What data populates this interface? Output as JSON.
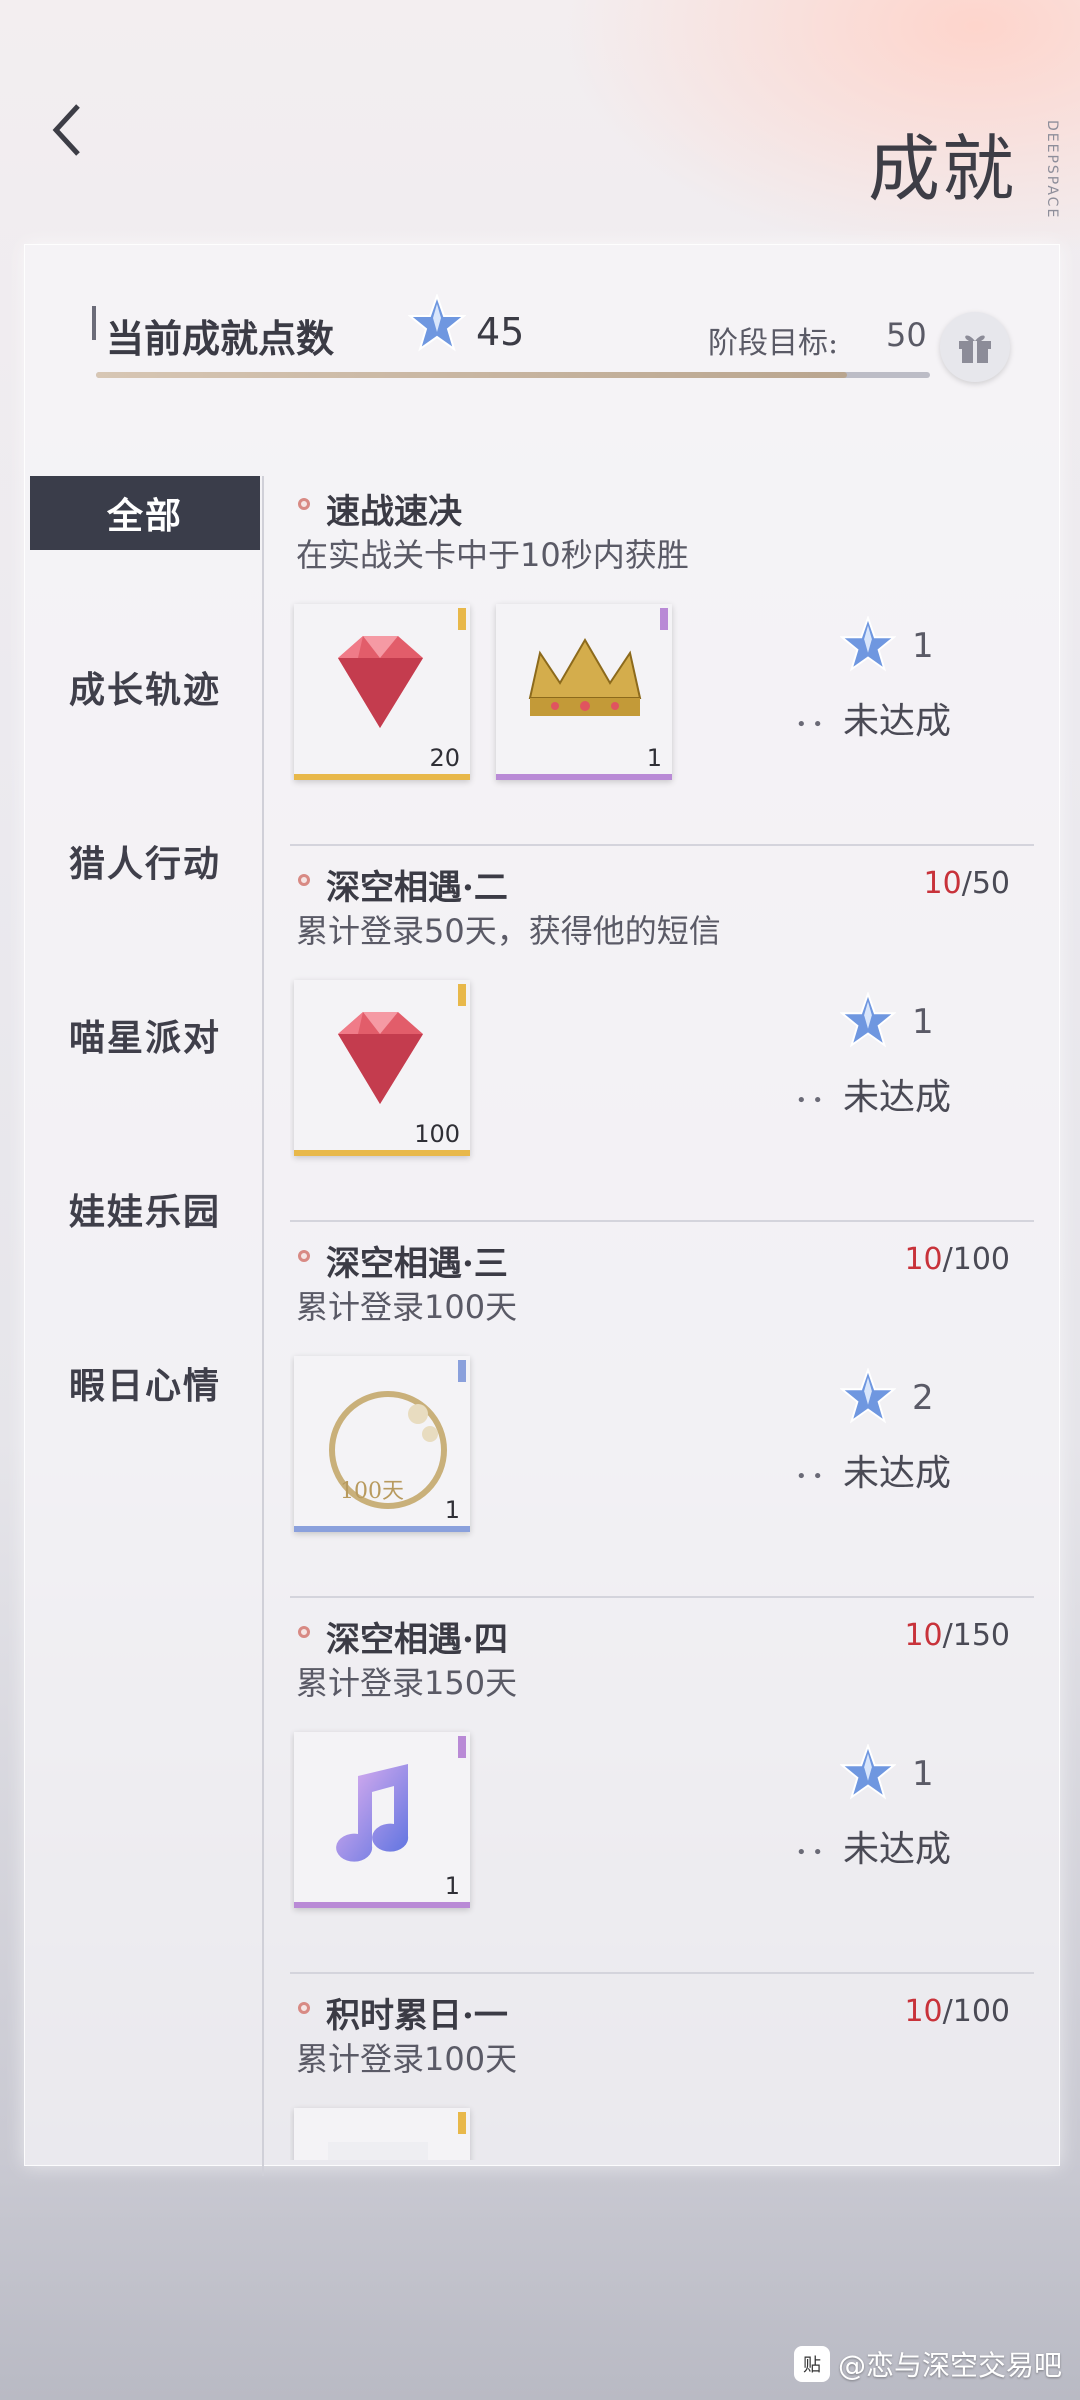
{
  "header": {
    "title": "成就",
    "brand_vertical": "DEEPSPACE"
  },
  "summary": {
    "points_label": "当前成就点数",
    "points_value": "45",
    "goal_label": "阶段目标:",
    "goal_value": "50",
    "progress_fraction": 0.9
  },
  "sidebar": {
    "items": [
      {
        "label": "全部",
        "active": true
      },
      {
        "label": "成长轨迹"
      },
      {
        "label": "猎人行动"
      },
      {
        "label": "喵星派对"
      },
      {
        "label": "娃娃乐园"
      },
      {
        "label": "暇日心情"
      }
    ]
  },
  "achievements": [
    {
      "title": "速战速决",
      "desc": "在实战关卡中于10秒内获胜",
      "progress_current": "",
      "progress_total": "",
      "rewards": [
        {
          "icon": "red-diamond-icon",
          "qty": "20",
          "bar_color": "#e8b84a"
        },
        {
          "icon": "gold-crown-icon",
          "qty": "1",
          "bar_color": "#b98ad6"
        }
      ],
      "star_count": "1",
      "status": "未达成"
    },
    {
      "title": "深空相遇·二",
      "desc": "累计登录50天，获得他的短信",
      "progress_current": "10",
      "progress_total": "/50",
      "rewards": [
        {
          "icon": "red-diamond-icon",
          "qty": "100",
          "bar_color": "#e8b84a"
        }
      ],
      "star_count": "1",
      "status": "未达成"
    },
    {
      "title": "深空相遇·三",
      "desc": "累计登录100天",
      "progress_current": "10",
      "progress_total": "/100",
      "rewards": [
        {
          "icon": "floral-frame-icon",
          "qty": "1",
          "bar_color": "#8aa0dc"
        }
      ],
      "star_count": "2",
      "status": "未达成"
    },
    {
      "title": "深空相遇·四",
      "desc": "累计登录150天",
      "progress_current": "10",
      "progress_total": "/150",
      "rewards": [
        {
          "icon": "music-note-icon",
          "qty": "1",
          "bar_color": "#b98ad6"
        }
      ],
      "star_count": "1",
      "status": "未达成"
    },
    {
      "title": "积时累日·一",
      "desc": "累计登录100天",
      "progress_current": "10",
      "progress_total": "/100",
      "rewards": [
        {
          "icon": "reward-placeholder-icon",
          "qty": "",
          "bar_color": "#e8b84a"
        }
      ],
      "star_count": "",
      "status": ""
    }
  ],
  "watermark": {
    "text": "@恋与深空交易吧",
    "icon_label": "贴"
  },
  "colors": {
    "accent_red": "#c8323a",
    "sidebar_active_bg": "#3a3d4a",
    "star_blue": "#5a86d8"
  }
}
